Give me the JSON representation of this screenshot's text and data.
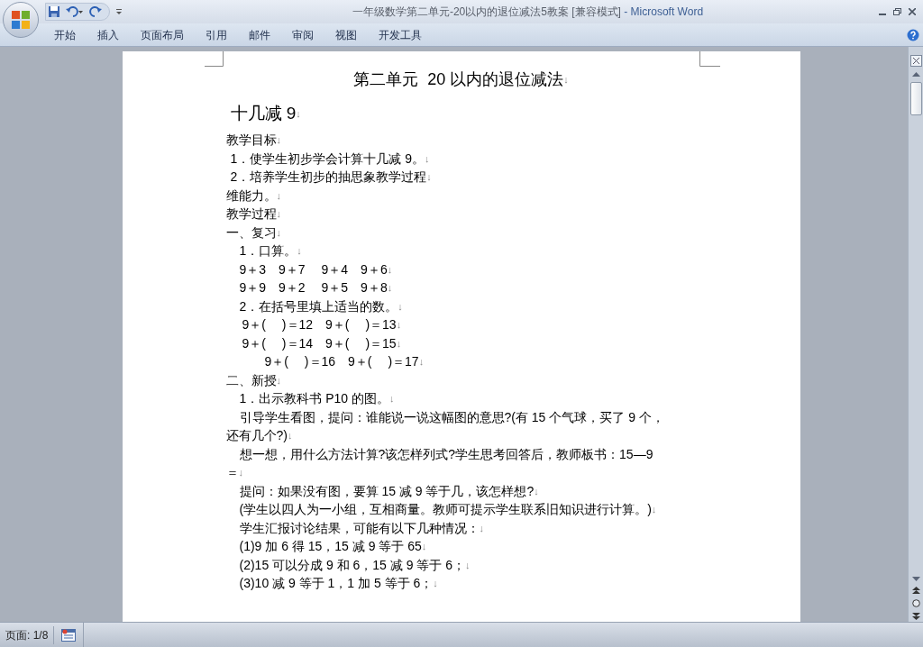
{
  "window": {
    "document_title": "一年级数学第二单元-20以内的退位减法5教案 [兼容模式]",
    "separator": " - ",
    "app_name": "Microsoft Word"
  },
  "tabs": [
    "开始",
    "插入",
    "页面布局",
    "引用",
    "邮件",
    "审阅",
    "视图",
    "开发工具"
  ],
  "document": {
    "paragraphs": [
      {
        "kind": "title",
        "text": "第二单元  20 以内的退位减法",
        "mark": "↓"
      },
      {
        "kind": "heading",
        "text": "十几减 9",
        "mark": "↓"
      },
      {
        "kind": "flush",
        "text": "教学目标",
        "mark": "↓"
      },
      {
        "kind": "numbered",
        "text": "1．使学生初步学会计算十几减 9。",
        "mark": "↓"
      },
      {
        "kind": "numbered",
        "text": "2．培养学生初步的抽思象教学过程",
        "mark": "↓"
      },
      {
        "kind": "flush",
        "text": "维能力。",
        "mark": "↓"
      },
      {
        "kind": "flush",
        "text": "教学过程",
        "mark": "↓"
      },
      {
        "kind": "flush",
        "text": "一、复习",
        "mark": "↓"
      },
      {
        "kind": "indented",
        "text": "1．口算。",
        "mark": "↓"
      },
      {
        "kind": "indented",
        "text": "9＋3　9＋7　 9＋4　9＋6",
        "mark": "↓"
      },
      {
        "kind": "indented",
        "text": "9＋9　9＋2　 9＋5　9＋8",
        "mark": "↓"
      },
      {
        "kind": "indented",
        "text": "2．在括号里填上适当的数。",
        "mark": "↓"
      },
      {
        "kind": "formula",
        "text": "9＋(　 )＝12　9＋(　 )＝13",
        "mark": "↓"
      },
      {
        "kind": "formula",
        "text": "9＋(　 )＝14　9＋(　 )＝15",
        "mark": "↓"
      },
      {
        "kind": "formula-deep",
        "text": "9＋(　 )＝16　9＋(　 )＝17",
        "mark": "↓"
      },
      {
        "kind": "flush",
        "text": "二、新授",
        "mark": "↓"
      },
      {
        "kind": "indented",
        "text": "1．出示教科书 P10 的图。",
        "mark": "↓"
      },
      {
        "kind": "indented",
        "text": "引导学生看图，提问：谁能说一说这幅图的意思?(有 15 个气球，买了 9 个，"
      },
      {
        "kind": "flush",
        "text": "还有几个?)",
        "mark": "↓"
      },
      {
        "kind": "indented",
        "text": "想一想，用什么方法计算?该怎样列式?学生思考回答后，教师板书：15—9"
      },
      {
        "kind": "flush",
        "text": "＝",
        "mark": "↓"
      },
      {
        "kind": "indented",
        "text": "提问：如果没有图，要算 15 减 9 等于几，该怎样想?",
        "mark": "↓"
      },
      {
        "kind": "indented",
        "text": "(学生以四人为一小组，互相商量。教师可提示学生联系旧知识进行计算。)",
        "mark": "↓"
      },
      {
        "kind": "indented",
        "text": "学生汇报讨论结果，可能有以下几种情况：",
        "mark": "↓"
      },
      {
        "kind": "indented",
        "text": "(1)9 加 6 得 15，15 减 9 等于 65",
        "mark": "↓"
      },
      {
        "kind": "indented",
        "text": "(2)15 可以分成 9 和 6，15 减 9 等于 6；",
        "mark": "↓"
      },
      {
        "kind": "indented",
        "text": "(3)10 减 9 等于 1，1 加 5 等于 6；",
        "mark": "↓"
      }
    ]
  },
  "status_bar": {
    "page": "页面: 1/8"
  }
}
